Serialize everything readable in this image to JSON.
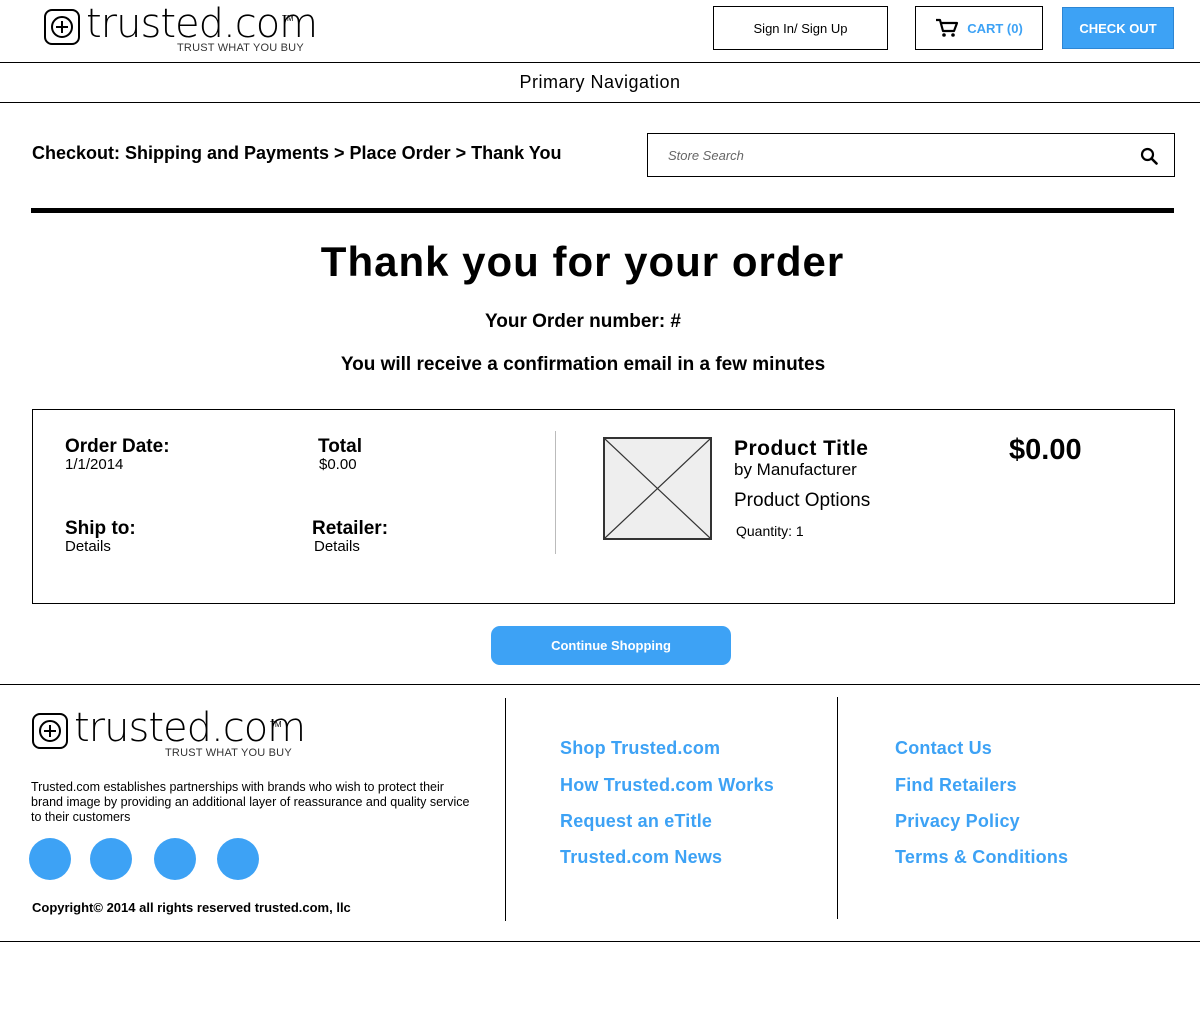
{
  "header": {
    "logo": {
      "word": "trusted.com",
      "tm": "TM",
      "tagline": "TRUST WHAT YOU BUY"
    },
    "signin_label": "Sign In/ Sign Up",
    "cart_label": "CART (0)",
    "cart_icon": "shopping-cart-icon",
    "checkout_label": "CHECK OUT",
    "accent_color": "#3da2f5"
  },
  "nav": {
    "label": "Primary Navigation"
  },
  "breadcrumb": "Checkout: Shipping and Payments > Place Order > Thank You",
  "search": {
    "placeholder": "Store Search",
    "icon": "search-icon"
  },
  "main": {
    "title": "Thank you for your order",
    "order_number": "Your Order number: #",
    "confirmation": "You will receive a confirmation email in a few minutes"
  },
  "summary": {
    "order_date_label": "Order Date:",
    "order_date_value": "1/1/2014",
    "total_label": "Total",
    "total_value": "$0.00",
    "ship_label": "Ship to:",
    "ship_value": "Details",
    "retailer_label": "Retailer:",
    "retailer_value": "Details",
    "product": {
      "title": "Product Title",
      "manufacturer": "by Manufacturer",
      "options": "Product Options",
      "quantity": "Quantity: 1",
      "price": "$0.00",
      "image_icon": "image-placeholder-icon"
    }
  },
  "continue_label": "Continue Shopping",
  "footer": {
    "logo": {
      "word": "trusted.com",
      "tm": "TM",
      "tagline": "TRUST WHAT YOU BUY"
    },
    "description": "Trusted.com establishes partnerships with brands who wish to protect their brand image by providing an additional layer of reassurance and quality service to their customers",
    "social_icons": [
      "social-icon-1",
      "social-icon-2",
      "social-icon-3",
      "social-icon-4"
    ],
    "copyright": "Copyright© 2014 all rights reserved trusted.com, llc",
    "links_col1": [
      "Shop Trusted.com",
      "How Trusted.com Works",
      "Request an eTitle",
      "Trusted.com News"
    ],
    "links_col2": [
      "Contact Us",
      "Find Retailers",
      "Privacy Policy",
      "Terms & Conditions"
    ]
  }
}
